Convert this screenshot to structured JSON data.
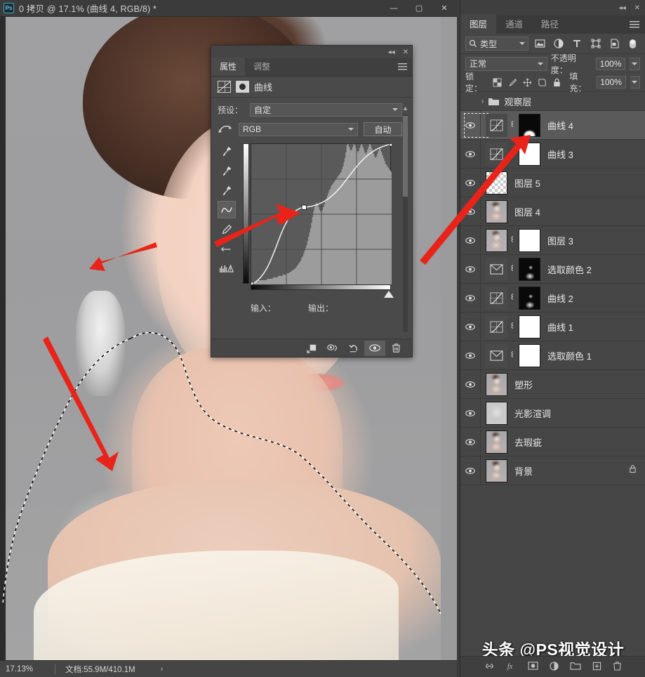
{
  "window": {
    "title": "0 拷贝 @ 17.1% (曲线 4, RGB/8) *",
    "logo": "Ps",
    "minimize": "—",
    "maximize": "▢",
    "close": "✕"
  },
  "status_bar": {
    "zoom": "17.13%",
    "doc_size": "文档:55.9M/410.1M",
    "chevron": "›"
  },
  "properties_panel": {
    "collapse_icon": "◂◂",
    "close_icon": "✕",
    "tabs": [
      {
        "label": "属性",
        "active": true
      },
      {
        "label": "调整",
        "active": false
      }
    ],
    "header_title": "曲线",
    "preset_label": "预设：",
    "preset_value": "自定",
    "channel_value": "RGB",
    "auto_button": "自动",
    "input_label": "输入：",
    "output_label": "输出：",
    "tools": [
      "eyedropper-black-icon",
      "eyedropper-gray-icon",
      "eyedropper-white-icon",
      "curve-pencil-tool-icon",
      "pencil-tool-icon",
      "smooth-curve-icon",
      "histogram-warning-icon"
    ],
    "footer_buttons": [
      "clip-to-layer-icon",
      "view-previous-state-icon",
      "reset-adjustment-icon",
      "toggle-visibility-icon",
      "delete-adjustment-icon"
    ]
  },
  "curve_graph": {
    "grid_divisions": 4,
    "points": [
      {
        "input": 0,
        "output": 0
      },
      {
        "input": 96,
        "output": 140
      },
      {
        "input": 255,
        "output": 255
      }
    ],
    "black_point": 0,
    "white_point": 255,
    "histogram": [
      2,
      2,
      2,
      2,
      2,
      2,
      2,
      3,
      3,
      3,
      3,
      3,
      3,
      3,
      3,
      3,
      4,
      4,
      4,
      4,
      4,
      4,
      5,
      5,
      5,
      5,
      5,
      6,
      6,
      6,
      6,
      6,
      7,
      7,
      7,
      7,
      8,
      8,
      8,
      9,
      9,
      10,
      10,
      11,
      11,
      12,
      13,
      14,
      15,
      16,
      17,
      19,
      20,
      22,
      24,
      26,
      28,
      31,
      34,
      37,
      40,
      44,
      48,
      52,
      55,
      57,
      58,
      57,
      55,
      53,
      52,
      52,
      53,
      55,
      57,
      59,
      61,
      63,
      65,
      67,
      68,
      70,
      71,
      72,
      73,
      74,
      75,
      76,
      77,
      78,
      79,
      80,
      82,
      84,
      87,
      90,
      94,
      99,
      100,
      98,
      96,
      95,
      96,
      98,
      100,
      99,
      97,
      95,
      94,
      95,
      97,
      99,
      100,
      98,
      96,
      94,
      93,
      94,
      96,
      98,
      100,
      99,
      97,
      95,
      93,
      91,
      90,
      91,
      93,
      95,
      97,
      96,
      94,
      92,
      90,
      88,
      86,
      85,
      84,
      83,
      82,
      81,
      80
    ]
  },
  "layers_panel": {
    "collapse_icon": "◂◂",
    "close_icon": "✕",
    "tabs": [
      {
        "label": "图层",
        "active": true
      },
      {
        "label": "通道",
        "active": false
      },
      {
        "label": "路径",
        "active": false
      }
    ],
    "filter": {
      "search_icon": "search-icon",
      "kind_value": "类型",
      "icons": [
        "filter-pixel-icon",
        "filter-adjustment-icon",
        "filter-type-icon",
        "filter-shape-icon",
        "filter-smart-object-icon",
        "filter-toggle-icon"
      ]
    },
    "blend_mode": "正常",
    "opacity_label": "不透明度：",
    "opacity_value": "100%",
    "lock_label": "锁定：",
    "lock_icons": [
      "lock-transparency-icon",
      "lock-image-icon",
      "lock-position-icon",
      "lock-artboard-icon",
      "lock-all-icon"
    ],
    "fill_label": "填充：",
    "fill_value": "100%",
    "group": {
      "name": "观察层",
      "expand_arrow": "›",
      "folder_icon": "folder-icon"
    },
    "layers": [
      {
        "name": "曲线",
        "index": "4",
        "visible": true,
        "selected": true,
        "thumb": "adjustment-curves",
        "mask": "mask-painted",
        "linked": true,
        "locked": false
      },
      {
        "name": "曲线",
        "index": "3",
        "visible": true,
        "selected": false,
        "thumb": "adjustment-curves",
        "mask": "mask-white",
        "linked": true,
        "locked": false
      },
      {
        "name": "图层",
        "index": "5",
        "visible": true,
        "selected": false,
        "thumb": "transparent",
        "mask": null,
        "linked": false,
        "locked": false
      },
      {
        "name": "图层",
        "index": "4",
        "visible": true,
        "selected": false,
        "thumb": "portrait",
        "mask": null,
        "linked": false,
        "locked": false
      },
      {
        "name": "图层",
        "index": "3",
        "visible": true,
        "selected": false,
        "thumb": "portrait-alpha",
        "mask": "mask-white",
        "linked": true,
        "locked": false
      },
      {
        "name": "选取颜色",
        "index": "2",
        "visible": true,
        "selected": false,
        "thumb": "adjustment-selective-color",
        "mask": "mask-painted-2",
        "linked": true,
        "locked": false
      },
      {
        "name": "曲线",
        "index": "2",
        "visible": true,
        "selected": false,
        "thumb": "adjustment-curves",
        "mask": "mask-painted-2",
        "linked": true,
        "locked": false
      },
      {
        "name": "曲线",
        "index": "1",
        "visible": true,
        "selected": false,
        "thumb": "adjustment-curves",
        "mask": "mask-white",
        "linked": true,
        "locked": false
      },
      {
        "name": "选取颜色",
        "index": "1",
        "visible": true,
        "selected": false,
        "thumb": "adjustment-selective-color",
        "mask": "mask-white",
        "linked": true,
        "locked": false
      },
      {
        "name": "塑形",
        "index": "",
        "visible": true,
        "selected": false,
        "thumb": "portrait",
        "mask": null,
        "linked": false,
        "locked": false
      },
      {
        "name": "光影渲调",
        "index": "",
        "visible": true,
        "selected": false,
        "thumb": "gray-soft",
        "mask": null,
        "linked": false,
        "locked": false
      },
      {
        "name": "去瑕疵",
        "index": "",
        "visible": true,
        "selected": false,
        "thumb": "portrait",
        "mask": null,
        "linked": false,
        "locked": false
      },
      {
        "name": "背景",
        "index": "",
        "visible": true,
        "selected": false,
        "thumb": "portrait",
        "mask": null,
        "linked": false,
        "locked": true
      }
    ],
    "footer_icons": [
      "link-layers-icon",
      "layer-style-icon",
      "add-mask-icon",
      "new-adjustment-icon",
      "new-group-icon",
      "new-layer-icon",
      "delete-layer-icon"
    ]
  },
  "watermark": "头条 @PS视觉设计",
  "colors": {
    "panel_bg": "#464646",
    "canvas_bg": "#9b9b9d",
    "accent_red": "#e8241a",
    "text": "#e4e4e4",
    "selected_row": "#5a5a5a"
  }
}
